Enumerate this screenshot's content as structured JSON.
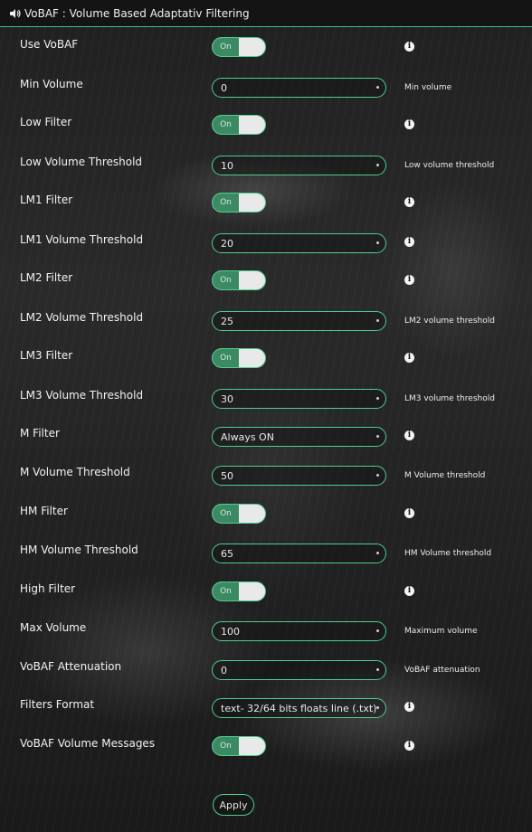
{
  "header": {
    "title": "VoBAF : Volume Based Adaptativ Filtering",
    "icon": "speaker-icon"
  },
  "rows": [
    {
      "label": "Use VoBAF",
      "type": "toggle",
      "value": "On",
      "info": true
    },
    {
      "label": "Min Volume",
      "type": "select",
      "value": "0",
      "hint": "Min volume"
    },
    {
      "label": "Low Filter",
      "type": "toggle",
      "value": "On",
      "info": true
    },
    {
      "label": "Low Volume Threshold",
      "type": "select",
      "value": "10",
      "hint": "Low volume threshold"
    },
    {
      "label": "LM1 Filter",
      "type": "toggle",
      "value": "On",
      "info": true
    },
    {
      "label": "LM1 Volume Threshold",
      "type": "select",
      "value": "20",
      "info": true
    },
    {
      "label": "LM2 Filter",
      "type": "toggle",
      "value": "On",
      "info": true
    },
    {
      "label": "LM2 Volume Threshold",
      "type": "select",
      "value": "25",
      "hint": "LM2 volume threshold"
    },
    {
      "label": "LM3 Filter",
      "type": "toggle",
      "value": "On",
      "info": true
    },
    {
      "label": "LM3 Volume Threshold",
      "type": "select",
      "value": "30",
      "hint": "LM3 volume threshold"
    },
    {
      "label": "M Filter",
      "type": "select",
      "value": "Always ON",
      "info": true
    },
    {
      "label": "M Volume Threshold",
      "type": "select",
      "value": "50",
      "hint": "M Volume threshold"
    },
    {
      "label": "HM Filter",
      "type": "toggle",
      "value": "On",
      "info": true
    },
    {
      "label": "HM Volume Threshold",
      "type": "select",
      "value": "65",
      "hint": "HM Volume threshold"
    },
    {
      "label": "High Filter",
      "type": "toggle",
      "value": "On",
      "info": true
    },
    {
      "label": "Max Volume",
      "type": "select",
      "value": "100",
      "hint": "Maximum volume"
    },
    {
      "label": "VoBAF Attenuation",
      "type": "select",
      "value": "0",
      "hint": "VoBAF attenuation"
    },
    {
      "label": "Filters Format",
      "type": "select",
      "value": "text- 32/64 bits floats line (.txt)",
      "info": true
    },
    {
      "label": "VoBAF Volume Messages",
      "type": "toggle",
      "value": "On",
      "info": true
    }
  ],
  "apply_label": "Apply",
  "info_glyph": "i",
  "colors": {
    "accent": "#4ecf8f",
    "toggle_on": "#3b8a64",
    "header_bg": "#141414"
  }
}
